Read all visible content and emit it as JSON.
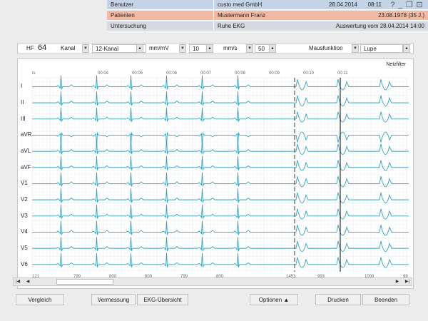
{
  "header": {
    "user_label": "Benutzer",
    "user_value": "custo med GmbH",
    "date": "28.04.2014",
    "time": "08:11",
    "patient_label": "Patienten",
    "patient_name": "Mustermann Franz",
    "patient_birth": "23.08.1978 (35 J.)",
    "exam_label": "Untersuchung",
    "exam_value": "Ruhe EKG",
    "evaluation": "Auswertung vom 28.04.2014 14:00",
    "win_help": "?",
    "win_min": "_",
    "win_restore": "❐",
    "win_close": "⊡"
  },
  "toolbar": {
    "hf_label": "HF",
    "hf_value": "64",
    "kanal_label": "Kanal",
    "kanal_value": "12-Kanal",
    "amp_unit": "mm/mV",
    "amp_value": "10",
    "speed_unit": "mm/s",
    "speed_value": "50",
    "mouse_label": "Mausfunktion",
    "mouse_value": "Lupe"
  },
  "ecg": {
    "filter": "Netzfilter",
    "leads": [
      "I",
      "II",
      "III",
      "aVR",
      "aVL",
      "aVF",
      "V1",
      "V2",
      "V3",
      "V4",
      "V5",
      "V6"
    ],
    "time_ticks": [
      "ts",
      "00:04",
      "00:05",
      "00:06",
      "00:07",
      "00:08",
      "00:09",
      "00:10",
      "00:11"
    ],
    "rr_values": [
      "121",
      "799",
      "800",
      "800",
      "799",
      "800",
      "1453",
      "993",
      "1000",
      "99"
    ],
    "trace_color": "#3aa0b8",
    "grid_minor": "#eef3f6",
    "grid_major": "#d8e2ea"
  },
  "buttons": {
    "compare": "Vergleich",
    "measure": "Vermessung",
    "overview": "EKG-Übersicht",
    "options": "Optionen",
    "print": "Drucken",
    "close": "Beenden"
  }
}
